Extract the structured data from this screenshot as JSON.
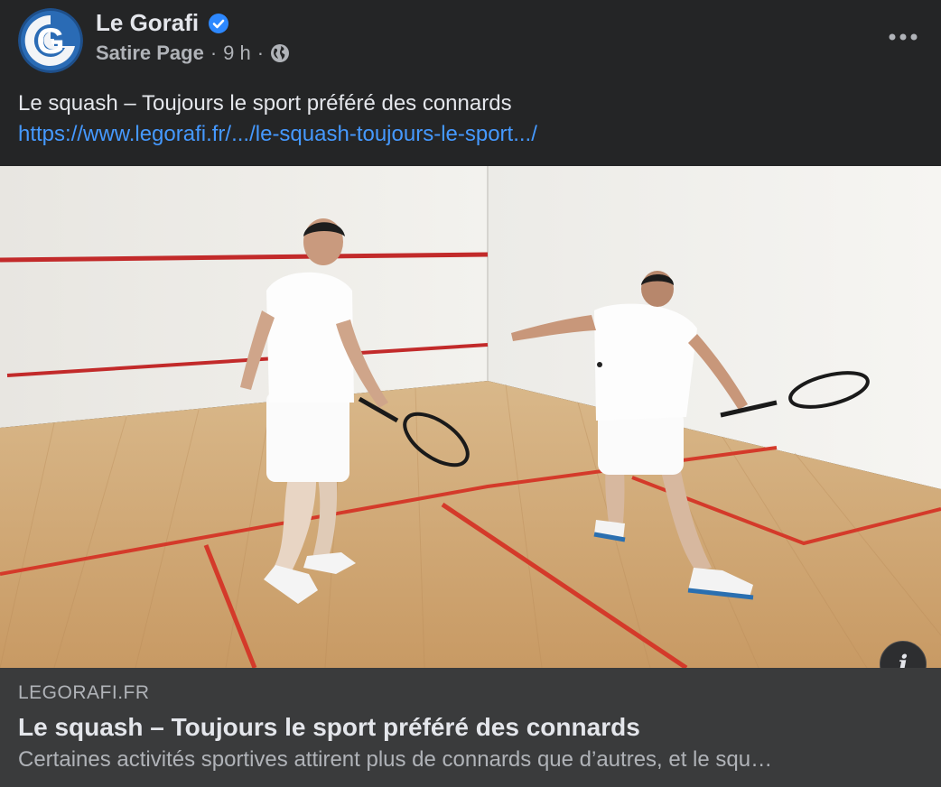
{
  "post": {
    "page_name": "Le Gorafi",
    "category": "Satire Page",
    "time": "9 h",
    "separator": "·",
    "text": "Le squash – Toujours le sport préféré des connards",
    "link": "https://www.legorafi.fr/.../le-squash-toujours-le-sport.../",
    "avatar_letter": "G"
  },
  "link_card": {
    "domain": "LEGORAFI.FR",
    "title": "Le squash – Toujours le sport préféré des connards",
    "description": "Certaines activités sportives attirent plus de connards que d’autres, et le squ…"
  },
  "colors": {
    "background": "#242526",
    "card": "#3a3b3c",
    "link": "#4599ff",
    "verified": "#2d88ff"
  },
  "icons": {
    "verified": "verified-badge-icon",
    "audience": "globe-icon",
    "more": "more-options-icon",
    "info": "info-icon"
  }
}
